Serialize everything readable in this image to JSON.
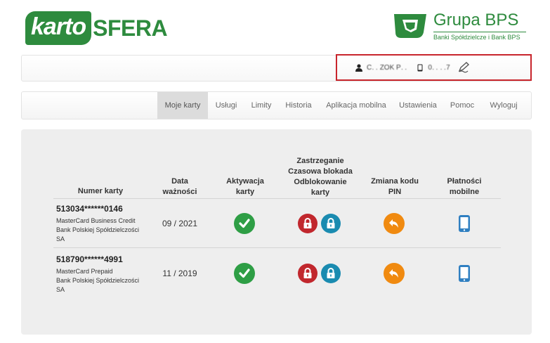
{
  "header": {
    "logo_left_part1": "karto",
    "logo_left_part2": "SFERA",
    "brand_title": "Grupa BPS",
    "brand_subtitle": "Banki Spółdzielcze i Bank BPS"
  },
  "user": {
    "name": "C․ ․ ZOK P․ ․",
    "phone": "0․ ․ ․ ․7"
  },
  "nav": {
    "items": [
      "Moje karty",
      "Usługi",
      "Limity",
      "Historia",
      "Aplikacja mobilna",
      "Ustawienia",
      "Pomoc",
      "Wyloguj"
    ],
    "active": "Moje karty"
  },
  "table": {
    "headers": {
      "card_number": "Numer karty",
      "expiry_line1": "Data",
      "expiry_line2": "ważności",
      "activation_line1": "Aktywacja",
      "activation_line2": "karty",
      "block_line1": "Zastrzeganie",
      "block_line2": "Czasowa blokada",
      "block_line3": "Odblokowanie",
      "block_line4": "karty",
      "pin_line1": "Zmiana kodu",
      "pin_line2": "PIN",
      "mobile_line1": "Płatności",
      "mobile_line2": "mobilne"
    },
    "rows": [
      {
        "number": "513034******0146",
        "desc_line1": "MasterCard Business Credit",
        "desc_line2": "Bank Polskiej Spółdzielczości",
        "desc_line3": "SA",
        "expiry": "09 / 2021"
      },
      {
        "number": "518790******4991",
        "desc_line1": "MasterCard Prepaid",
        "desc_line2": "Bank Polskiej Spółdzielczości",
        "desc_line3": "SA",
        "expiry": "11 / 2019"
      }
    ]
  },
  "colors": {
    "brand_green": "#2e8b3e",
    "activate_green": "#2e9e45",
    "block_red": "#c1272d",
    "unlock_teal": "#1a8bb0",
    "pin_orange": "#f08a10",
    "phone_blue": "#2f7fc1",
    "highlight_red": "#c8252c"
  }
}
